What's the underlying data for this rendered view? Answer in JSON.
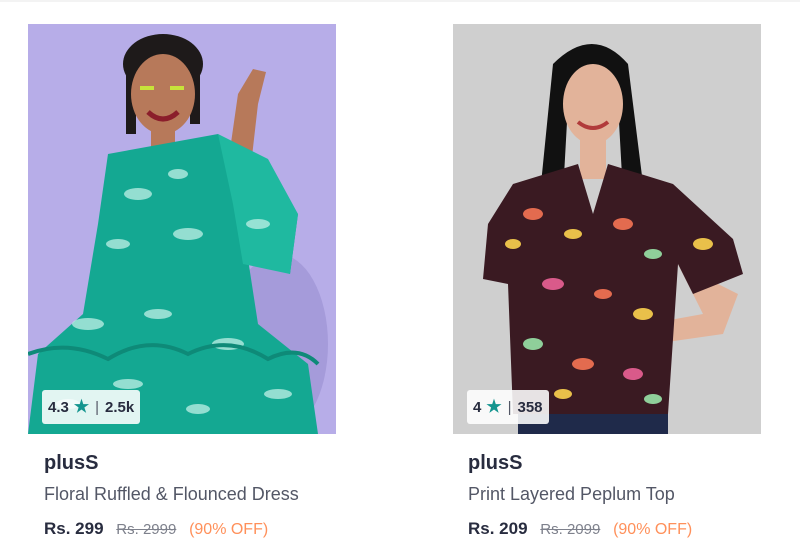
{
  "products": [
    {
      "rating": "4.3",
      "rating_count": "2.5k",
      "brand": "plusS",
      "title": "Floral Ruffled & Flounced Dress",
      "price": "Rs. 299",
      "mrp": "Rs. 2999",
      "discount": "(90% OFF)"
    },
    {
      "rating": "4",
      "rating_count": "358",
      "brand": "plusS",
      "title": "Print Layered Peplum Top",
      "price": "Rs. 209",
      "mrp": "Rs. 2099",
      "discount": "(90% OFF)"
    }
  ],
  "colors": {
    "star": "#14958f",
    "discount": "#ff905a",
    "brand_text": "#282c3f"
  },
  "icons": {
    "rating": "star-icon",
    "separator": "divider"
  }
}
